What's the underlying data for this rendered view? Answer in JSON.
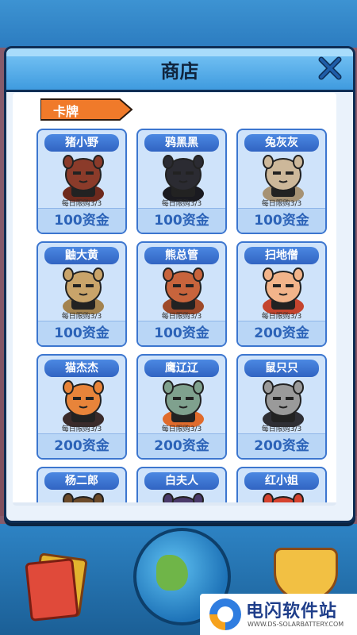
{
  "modal": {
    "title": "商店"
  },
  "section": {
    "label": "卡牌"
  },
  "cards": [
    {
      "name": "猪小野",
      "limit": "每日限购3/3",
      "price": "100资金",
      "color": "#8b3b2a",
      "accent": "#6e2a1d"
    },
    {
      "name": "鸦黑黑",
      "limit": "每日限购3/3",
      "price": "100资金",
      "color": "#2b2b32",
      "accent": "#1a1a20"
    },
    {
      "name": "兔灰灰",
      "limit": "每日限购3/3",
      "price": "100资金",
      "color": "#cdb89a",
      "accent": "#a69274"
    },
    {
      "name": "鼬大黄",
      "limit": "每日限购3/3",
      "price": "100资金",
      "color": "#c9a46a",
      "accent": "#a3834f"
    },
    {
      "name": "熊总管",
      "limit": "每日限购3/3",
      "price": "100资金",
      "color": "#c8643c",
      "accent": "#9e4a2a"
    },
    {
      "name": "扫地僧",
      "limit": "每日限购3/3",
      "price": "200资金",
      "color": "#f2b48a",
      "accent": "#c4442e"
    },
    {
      "name": "猫杰杰",
      "limit": "每日限购3/3",
      "price": "200资金",
      "color": "#e8843a",
      "accent": "#3a2b2b"
    },
    {
      "name": "鹰辽辽",
      "limit": "每日限购3/3",
      "price": "200资金",
      "color": "#7fa18e",
      "accent": "#e06b2c"
    },
    {
      "name": "鼠只只",
      "limit": "每日限购3/3",
      "price": "200资金",
      "color": "#9a9a9a",
      "accent": "#2f2f35"
    },
    {
      "name": "杨二郎",
      "limit": "",
      "price": "",
      "color": "#6b4a2a",
      "accent": "#e2b32e"
    },
    {
      "name": "白夫人",
      "limit": "",
      "price": "",
      "color": "#4a3a6a",
      "accent": "#ffffff"
    },
    {
      "name": "红小姐",
      "limit": "",
      "price": "",
      "color": "#d5432f",
      "accent": "#8a1f14"
    }
  ],
  "watermark": {
    "title": "电闪软件站",
    "url": "WWW.DS-SOLARBATTERY.COM"
  },
  "colors": {
    "accent": "#3c76cf",
    "tab": "#f07a2a",
    "header": "#3f9bdf"
  }
}
